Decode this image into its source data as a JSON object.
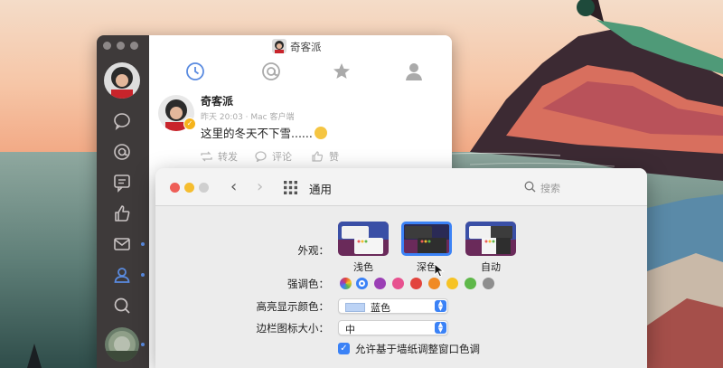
{
  "weibo": {
    "title": "奇客派",
    "post": {
      "author": "奇客派",
      "meta": "昨天 20:03 · Mac 客户端",
      "text": "这里的冬天不下雪......",
      "actions": {
        "repost": "转发",
        "comment": "评论",
        "like": "赞"
      }
    },
    "tabs": [
      "clock-icon",
      "at-icon",
      "star-icon",
      "person-icon"
    ],
    "sidebar": [
      "comment-icon",
      "mention-icon",
      "message-icon",
      "like-icon",
      "mail-icon",
      "contacts-icon",
      "search-icon"
    ]
  },
  "prefs": {
    "title": "通用",
    "search_placeholder": "搜索",
    "appearance": {
      "label": "外观：",
      "options": [
        {
          "name": "浅色",
          "selected": false
        },
        {
          "name": "深色",
          "selected": true
        },
        {
          "name": "自动",
          "selected": false
        }
      ]
    },
    "accent": {
      "label": "强调色：",
      "colors": [
        "multicolor",
        "#3b82f6",
        "#9b3fb5",
        "#e7518f",
        "#e2443d",
        "#f08a24",
        "#f6c325",
        "#5fb84a",
        "#8e8e8e"
      ],
      "selected_index": 1
    },
    "highlight": {
      "label": "高亮显示颜色：",
      "value": "蓝色"
    },
    "sidebar_icon_size": {
      "label": "边栏图标大小：",
      "value": "中"
    },
    "wallpaper_tinting": {
      "label": "允许基于墙纸调整窗口色调",
      "checked": true
    }
  },
  "colors": {
    "accent": "#3b82f6",
    "close": "#ee5e57",
    "minimize": "#f5bd2f",
    "sidebar": "#3e3a3a"
  }
}
